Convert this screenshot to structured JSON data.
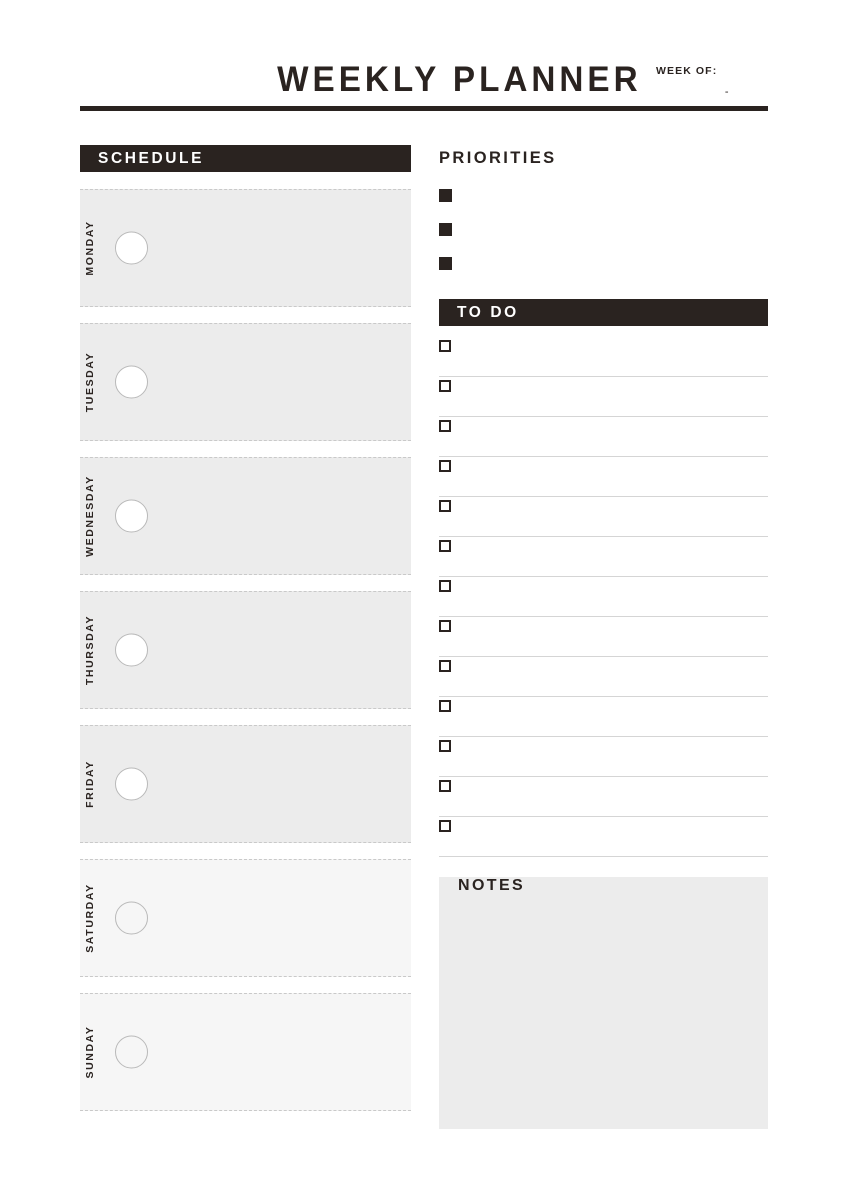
{
  "header": {
    "title": "WEEKLY PLANNER",
    "week_of_label": "WEEK OF:",
    "week_of_value": "-"
  },
  "schedule": {
    "heading": "SCHEDULE",
    "days": [
      {
        "label": "MONDAY",
        "kind": "weekday"
      },
      {
        "label": "TUESDAY",
        "kind": "weekday"
      },
      {
        "label": "WEDNESDAY",
        "kind": "weekday"
      },
      {
        "label": "THURSDAY",
        "kind": "weekday"
      },
      {
        "label": "FRIDAY",
        "kind": "weekday"
      },
      {
        "label": "SATURDAY",
        "kind": "weekend"
      },
      {
        "label": "SUNDAY",
        "kind": "weekend"
      }
    ]
  },
  "priorities": {
    "heading": "PRIORITIES",
    "items": [
      {
        "text": ""
      },
      {
        "text": ""
      },
      {
        "text": ""
      }
    ]
  },
  "todo": {
    "heading": "TO DO",
    "items": [
      {
        "text": ""
      },
      {
        "text": ""
      },
      {
        "text": ""
      },
      {
        "text": ""
      },
      {
        "text": ""
      },
      {
        "text": ""
      },
      {
        "text": ""
      },
      {
        "text": ""
      },
      {
        "text": ""
      },
      {
        "text": ""
      },
      {
        "text": ""
      },
      {
        "text": ""
      },
      {
        "text": ""
      }
    ]
  },
  "notes": {
    "heading": "NOTES",
    "content": ""
  },
  "colors": {
    "ink": "#2a2320",
    "weekday_fill": "#ececec",
    "weekend_fill": "#f6f6f6",
    "rule": "#d5d5d5",
    "dashed_border": "#c9c9c9",
    "page": "#ffffff"
  }
}
